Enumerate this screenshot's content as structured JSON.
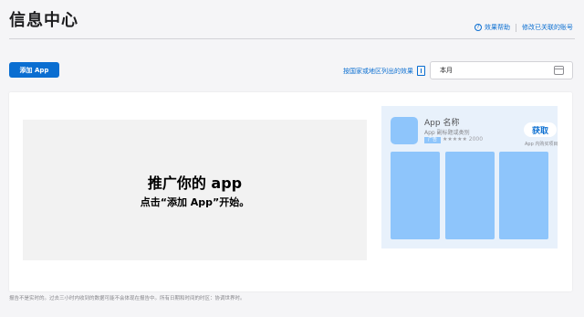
{
  "header": {
    "title": "信息中心",
    "help_link": "效果帮助",
    "account_link": "修改已关联的账号"
  },
  "toolbar": {
    "add_app_label": "添加 App",
    "country_link": "按国家或地区列出的效果",
    "date_range_value": "本月"
  },
  "promo": {
    "title": "推广你的 app",
    "subtitle": "点击“添加 App”开始。"
  },
  "preview": {
    "app_name": "App 名称",
    "app_subtitle": "App 副标题或类别",
    "ad_badge": "广告",
    "rating_text": "★★★★★ 2000",
    "get_label": "获取",
    "iap_note": "App 内购买项目",
    "screenshot_count": 3
  },
  "footer": {
    "note": "报告不是实时的。过去三小时内收到的数据可能不会体现在报告中。所有日期和时间的时区：协调世界时。"
  },
  "colors": {
    "accent": "#0a6ed1",
    "placeholder_blue": "#8ec5fb",
    "preview_bg": "#e8f1fb"
  }
}
